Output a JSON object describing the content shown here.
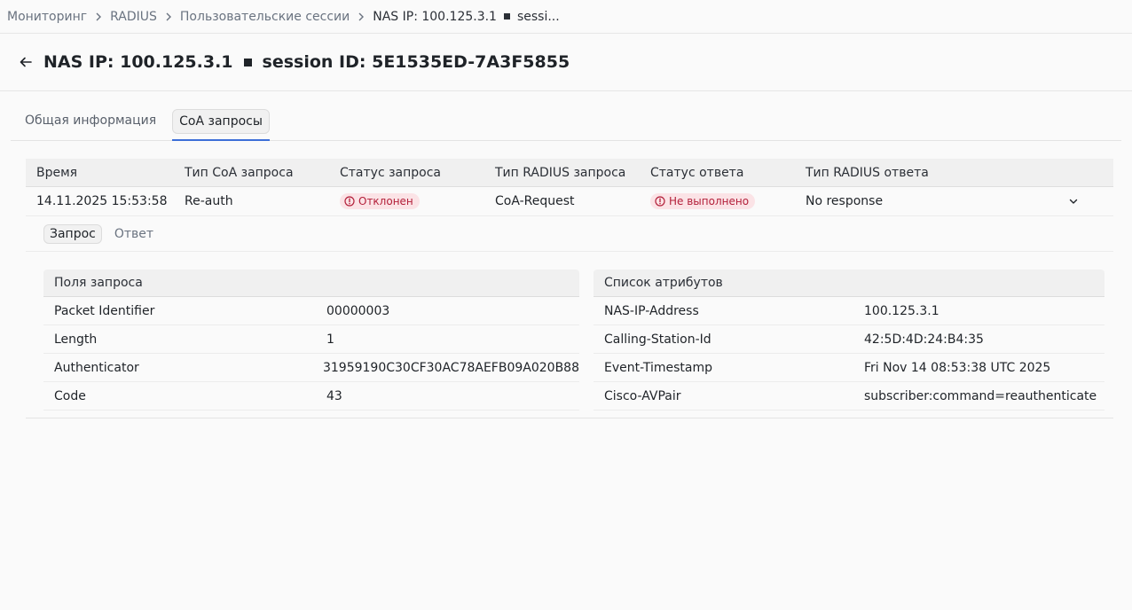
{
  "breadcrumb": {
    "items": [
      "Мониторинг",
      "RADIUS",
      "Пользовательские сессии"
    ],
    "current_prefix": "NAS IP: 100.125.3.1",
    "current_suffix": "sessi..."
  },
  "header": {
    "title_nas": "NAS IP: 100.125.3.1",
    "title_session": "session ID: 5E1535ED-7A3F5855"
  },
  "tabs": [
    {
      "label": "Общая информация",
      "active": false
    },
    {
      "label": "CoA запросы",
      "active": true
    }
  ],
  "table": {
    "columns": [
      "Время",
      "Тип CoA запроса",
      "Статус запроса",
      "Тип RADIUS запроса",
      "Статус ответа",
      "Тип RADIUS ответа"
    ],
    "rows": [
      {
        "time": "14.11.2025 15:53:58",
        "coa_type": "Re-auth",
        "request_status": "Отклонен",
        "radius_request_type": "CoA-Request",
        "response_status": "Не выполнено",
        "radius_response_type": "No response"
      }
    ]
  },
  "detail": {
    "subtabs": [
      "Запрос",
      "Ответ"
    ],
    "request_fields": {
      "title": "Поля запроса",
      "rows": [
        {
          "key": "Packet Identifier",
          "value": "00000003"
        },
        {
          "key": "Length",
          "value": "1"
        },
        {
          "key": "Authenticator",
          "value": "31959190C30CF30AC78AEFB09A020B88"
        },
        {
          "key": "Code",
          "value": "43"
        }
      ]
    },
    "attributes": {
      "title": "Список атрибутов",
      "rows": [
        {
          "key": "NAS-IP-Address",
          "value": "100.125.3.1"
        },
        {
          "key": "Calling-Station-Id",
          "value": "42:5D:4D:24:B4:35"
        },
        {
          "key": "Event-Timestamp",
          "value": "Fri Nov 14 08:53:38 UTC 2025"
        },
        {
          "key": "Cisco-AVPair",
          "value": "subscriber:command=reauthenticate"
        }
      ]
    }
  },
  "colors": {
    "error_badge_bg": "#fbe3e6",
    "error_badge_text": "#b3203a",
    "tab_active_underline": "#3d6fd8"
  }
}
